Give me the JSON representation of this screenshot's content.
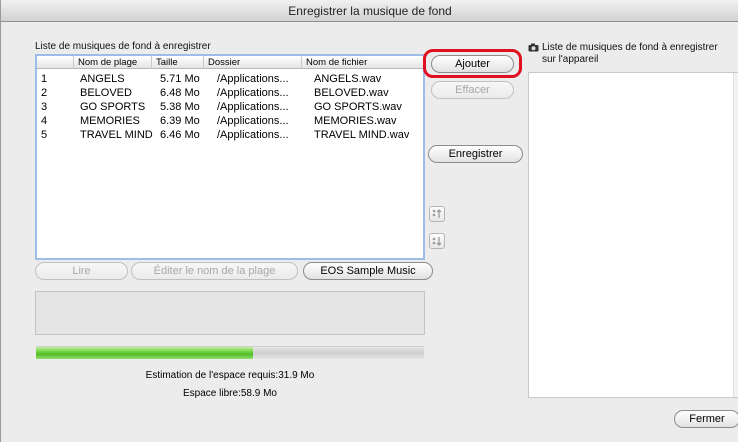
{
  "window": {
    "title": "Enregistrer la musique de fond"
  },
  "left_panel": {
    "label": "Liste de musiques de fond à enregistrer",
    "columns": [
      "",
      "Nom de plage",
      "Taille",
      "Dossier",
      "Nom de fichier"
    ],
    "rows": [
      {
        "num": "1",
        "name": "ANGELS",
        "size": "5.71 Mo",
        "folder": "/Applications...",
        "file": "ANGELS.wav"
      },
      {
        "num": "2",
        "name": "BELOVED",
        "size": "6.48 Mo",
        "folder": "/Applications...",
        "file": "BELOVED.wav"
      },
      {
        "num": "3",
        "name": "GO SPORTS",
        "size": "5.38 Mo",
        "folder": "/Applications...",
        "file": "GO SPORTS.wav"
      },
      {
        "num": "4",
        "name": "MEMORIES",
        "size": "6.39 Mo",
        "folder": "/Applications...",
        "file": "MEMORIES.wav"
      },
      {
        "num": "5",
        "name": "TRAVEL MIND",
        "size": "6.46 Mo",
        "folder": "/Applications...",
        "file": "TRAVEL MIND.wav"
      }
    ]
  },
  "buttons": {
    "ajouter": "Ajouter",
    "effacer": "Effacer",
    "enregistrer": "Enregistrer",
    "move_up_icon": "move-up-icon",
    "move_down_icon": "move-down-icon",
    "lire": "Lire",
    "editer": "Éditer le nom de la plage",
    "eos_sample": "EOS Sample Music",
    "fermer": "Fermer"
  },
  "progress": {
    "fraction": 0.56,
    "color": "#5cc52e"
  },
  "estimation": "Estimation de l'espace requis:31.9 Mo",
  "espace_libre": "Espace libre:58.9 Mo",
  "right_panel": {
    "icon": "camera-icon",
    "label_line1": "Liste de musiques de fond à enregistrer",
    "label_line2": "sur l'appareil"
  },
  "highlight_color": "#e01020"
}
